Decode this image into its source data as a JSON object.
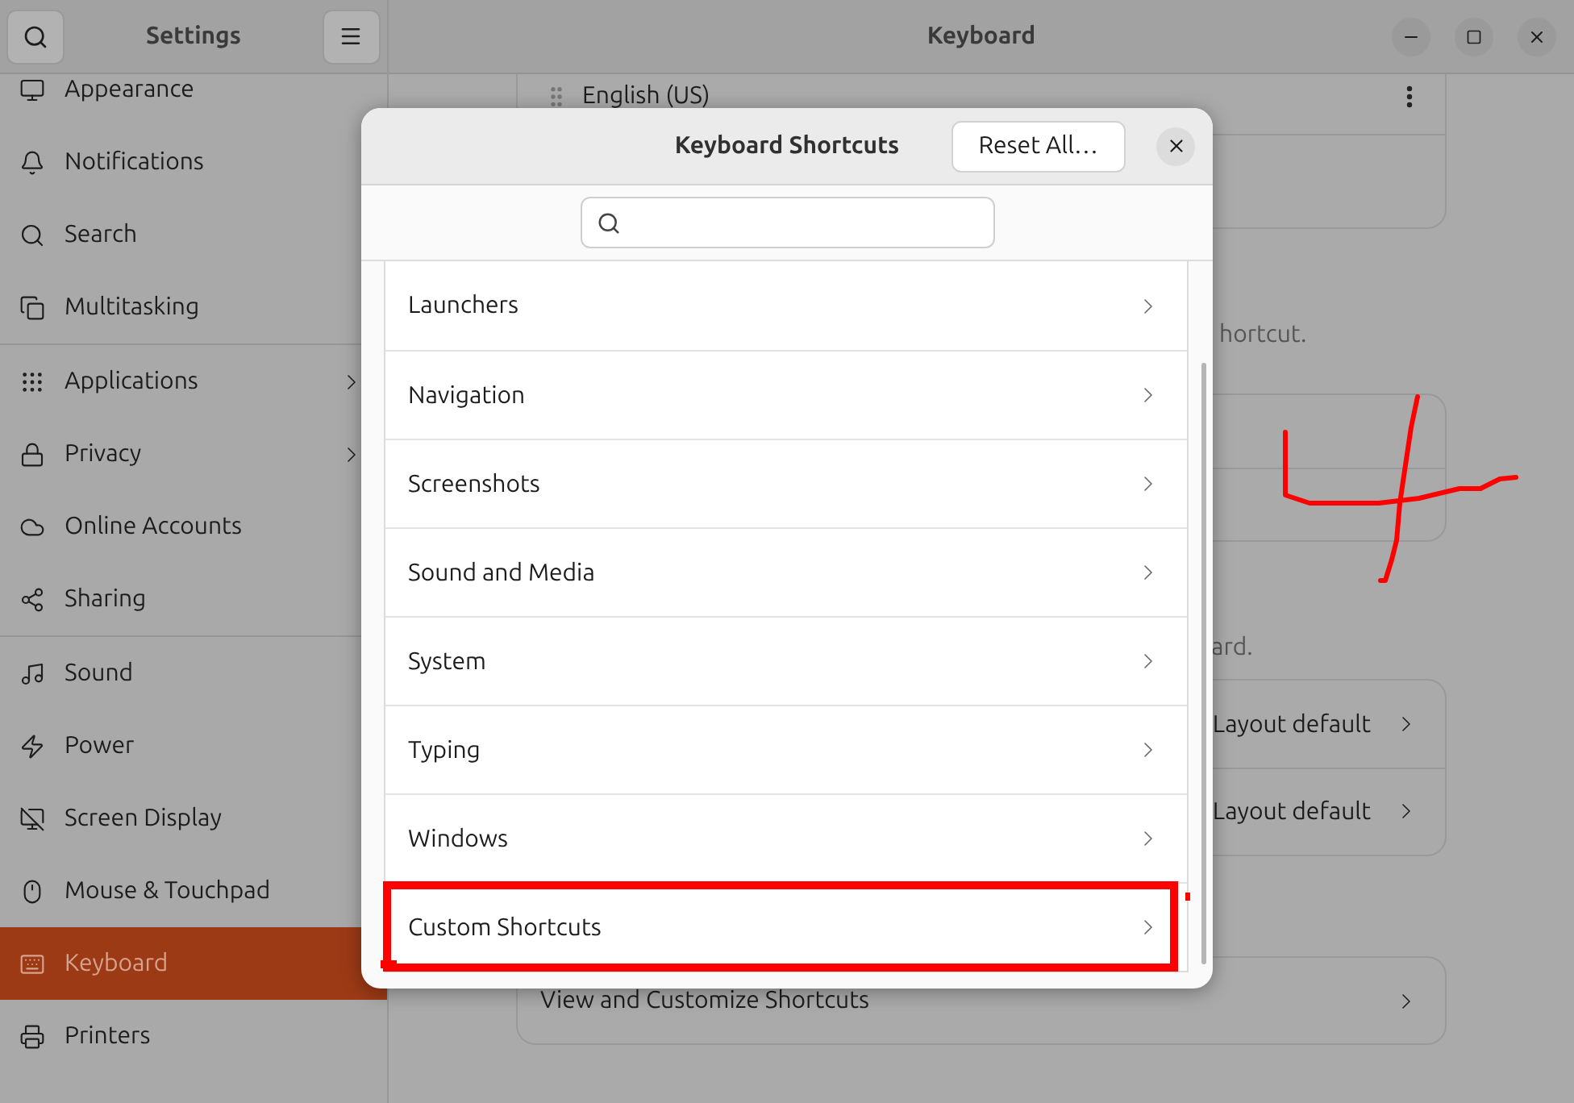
{
  "sidebar": {
    "title": "Settings",
    "groups": [
      [
        {
          "label": "Appearance",
          "selected": false,
          "submenu": false
        },
        {
          "label": "Notifications",
          "selected": false,
          "submenu": false
        },
        {
          "label": "Search",
          "selected": false,
          "submenu": false
        },
        {
          "label": "Multitasking",
          "selected": false,
          "submenu": false
        }
      ],
      [
        {
          "label": "Applications",
          "selected": false,
          "submenu": true
        },
        {
          "label": "Privacy",
          "selected": false,
          "submenu": true
        },
        {
          "label": "Online Accounts",
          "selected": false,
          "submenu": false
        },
        {
          "label": "Sharing",
          "selected": false,
          "submenu": false
        }
      ],
      [
        {
          "label": "Sound",
          "selected": false,
          "submenu": false
        },
        {
          "label": "Power",
          "selected": false,
          "submenu": false
        },
        {
          "label": "Screen Display",
          "selected": false,
          "submenu": false
        },
        {
          "label": "Mouse & Touchpad",
          "selected": false,
          "submenu": false
        },
        {
          "label": "Keyboard",
          "selected": true,
          "submenu": false
        },
        {
          "label": "Printers",
          "selected": false,
          "submenu": false
        }
      ]
    ]
  },
  "main": {
    "title": "Keyboard",
    "input_source": "English (US)",
    "text_1": "hortcut.",
    "text_2": "ard.",
    "layout_rows": [
      {
        "value": "Layout default"
      },
      {
        "value": "Layout default"
      }
    ],
    "shortcuts_row": "View and Customize Shortcuts"
  },
  "dialog": {
    "title": "Keyboard Shortcuts",
    "reset_button": "Reset All…",
    "categories": [
      {
        "label": "Launchers"
      },
      {
        "label": "Navigation"
      },
      {
        "label": "Screenshots"
      },
      {
        "label": "Sound and Media"
      },
      {
        "label": "System"
      },
      {
        "label": "Typing"
      },
      {
        "label": "Windows"
      },
      {
        "label": "Custom Shortcuts"
      }
    ]
  }
}
